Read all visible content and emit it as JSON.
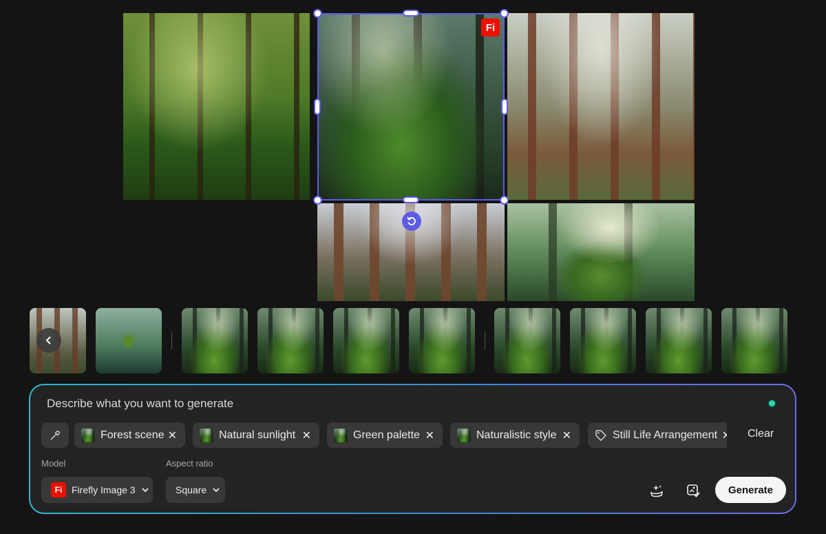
{
  "canvas": {
    "images": [
      {
        "name": "forest-image-top-left"
      },
      {
        "name": "forest-image-selected"
      },
      {
        "name": "forest-image-top-right"
      },
      {
        "name": "forest-image-bottom-middle"
      },
      {
        "name": "forest-image-bottom-right"
      }
    ],
    "badge": "Fi"
  },
  "filmstrip": {
    "thumbnail_count": 10
  },
  "prompt_panel": {
    "placeholder": "Describe what you want to generate",
    "chips": [
      {
        "label": "Forest scene"
      },
      {
        "label": "Natural sunlight"
      },
      {
        "label": "Green palette"
      },
      {
        "label": "Naturalistic style"
      },
      {
        "label": "Still Life Arrangement"
      }
    ],
    "clear_label": "Clear",
    "model_label": "Model",
    "model_badge": "Fi",
    "model_value": "Firefly Image 3",
    "aspect_label": "Aspect ratio",
    "aspect_value": "Square",
    "generate_label": "Generate",
    "accent_color": "#5c5ce6",
    "brand_color": "#eb1000"
  }
}
